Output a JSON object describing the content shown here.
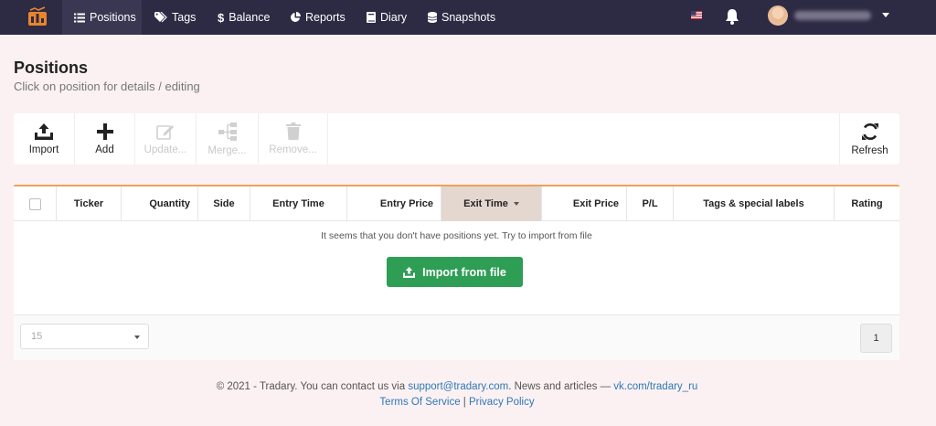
{
  "nav": {
    "items": [
      {
        "label": "Positions",
        "icon": "list-icon",
        "active": true
      },
      {
        "label": "Tags",
        "icon": "tag-icon"
      },
      {
        "label": "Balance",
        "icon": "dollar-icon"
      },
      {
        "label": "Reports",
        "icon": "pie-chart-icon"
      },
      {
        "label": "Diary",
        "icon": "book-icon"
      },
      {
        "label": "Snapshots",
        "icon": "database-icon"
      }
    ]
  },
  "page": {
    "title": "Positions",
    "subtitle": "Click on position for details / editing"
  },
  "toolbar": {
    "import": "Import",
    "add": "Add",
    "update": "Update...",
    "merge": "Merge...",
    "remove": "Remove...",
    "refresh": "Refresh"
  },
  "table": {
    "columns": [
      "Ticker",
      "Quantity",
      "Side",
      "Entry Time",
      "Entry Price",
      "Exit Time",
      "Exit Price",
      "P/L",
      "Tags & special labels",
      "Rating"
    ],
    "sorted_column": "Exit Time",
    "empty_message": "It seems that you don't have positions yet. Try to import from file",
    "import_button": "Import from file",
    "page_size": "15",
    "current_page": "1"
  },
  "footer": {
    "prefix": "© 2021 - Tradary. You can contact us via ",
    "email": "support@tradary.com",
    "middle": ". News and articles — ",
    "vk": "vk.com/tradary_ru",
    "terms": "Terms Of Service",
    "separator": " | ",
    "privacy": "Privacy Policy"
  },
  "colors": {
    "navbar": "#2d2a44",
    "accent_orange": "#f0a05a",
    "import_green": "#2e9e54",
    "link_blue": "#2f78b7"
  }
}
